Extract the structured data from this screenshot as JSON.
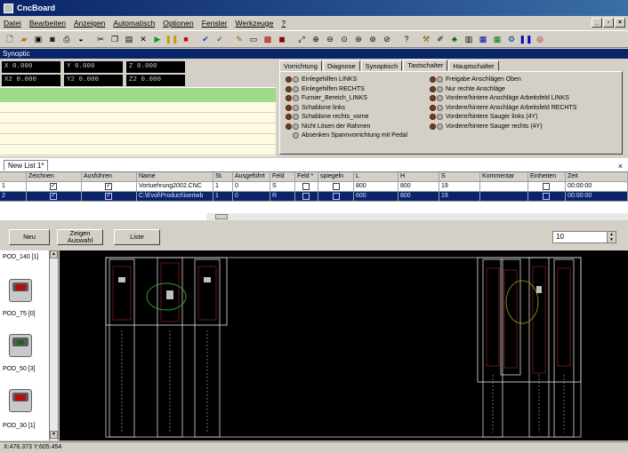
{
  "window": {
    "title": "CncBoard"
  },
  "mdi_controls": [
    "_",
    "▫",
    "×"
  ],
  "menu": [
    "Datei",
    "Bearbeiten",
    "Anzeigen",
    "Automatisch",
    "Optionen",
    "Fenster",
    "Werkzeuge",
    "?"
  ],
  "toolbar_icons": [
    "new-icon",
    "open-icon",
    "save-icon",
    "save-all-icon",
    "print-icon",
    "preview-icon",
    "cut-icon",
    "copy-icon",
    "paste-icon",
    "delete-icon",
    "play-icon",
    "pause-icon",
    "stop-icon",
    "check-icon",
    "validate-icon",
    "edit-icon",
    "display-icon",
    "red-square-icon",
    "stop-square-icon",
    "zoom-fit-icon",
    "zoom-in-icon",
    "zoom-out-icon",
    "zoom-window-icon",
    "zoom-all-icon",
    "zoom-prev-icon",
    "help-icon",
    "tool-icon",
    "pen-icon",
    "tree-icon",
    "chart-icon",
    "save-db-icon",
    "green-grid-icon",
    "gear-icon",
    "pause-blue-icon",
    "target-icon"
  ],
  "synoptic": {
    "title": "Synoptic"
  },
  "coords": {
    "x1": "X  0.000",
    "y1": "Y  0.000",
    "z1": "Z  0.000",
    "x2": "X2  0.000",
    "y2": "Y2  0.000",
    "z2": "Z2  0.000"
  },
  "tabs": [
    "Vorrichtung",
    "Diagnose",
    "Synoptisch",
    "Tastschalter",
    "Hauptschalter"
  ],
  "active_tab": "Tastschalter",
  "options_left": [
    "Einlegehilfen LINKS",
    "Einlegehilfen RECHTS",
    "Furnier_Bereich_LINKS",
    "Schablone links",
    "Schablone rechts_vorne",
    "Nicht Lösen der Rahmen",
    "Absenken Spannvorrichtung mit Pedal"
  ],
  "options_right": [
    "Freigabe Anschlägen Oben",
    "Nur rechte Anschläge",
    "Vordere/hintere Anschläge Arbeitsfeld LINKS",
    "Vordere/hintere Anschläge Arbeitsfeld RECHTS",
    "Vordere/hintere Sauger links (4Y)",
    "Vordere/hintere Sauger rechts (4Y)"
  ],
  "list": {
    "tab_label": "New List 1*",
    "close": "×",
    "columns": [
      "",
      "Zeichnen",
      "Ausführen",
      "Name",
      "St.",
      "Ausgeführt",
      "Feld",
      "Feld *",
      "spiegeln",
      "L",
      "H",
      "S",
      "Kommentar",
      "Einheiten",
      "Zeit"
    ],
    "rows": [
      [
        "1",
        "✓",
        "✓",
        "Vortuehrung2002.CNC",
        "1",
        "0",
        "S",
        "",
        "",
        "800",
        "800",
        "19",
        "",
        "",
        "00:00:00"
      ],
      [
        "2",
        "✓",
        "✓",
        "C:\\Evol\\Product\\iseriwb",
        "1",
        "0",
        "R",
        "",
        "",
        "600",
        "800",
        "19",
        "",
        "",
        "00:00:00"
      ]
    ]
  },
  "buttons": {
    "neu": "Neu",
    "zeigen": "Zeigen Auswahl",
    "liste": "Liste",
    "counter": "10"
  },
  "pods": [
    {
      "label": "POD_140",
      "count": "[1]"
    },
    {
      "label": "POD_75",
      "count": "[0]"
    },
    {
      "label": "POD_50",
      "count": "[3]"
    },
    {
      "label": "POD_30",
      "count": "[1]"
    }
  ],
  "status": {
    "coords": "X:476.373 Y:605.454"
  }
}
